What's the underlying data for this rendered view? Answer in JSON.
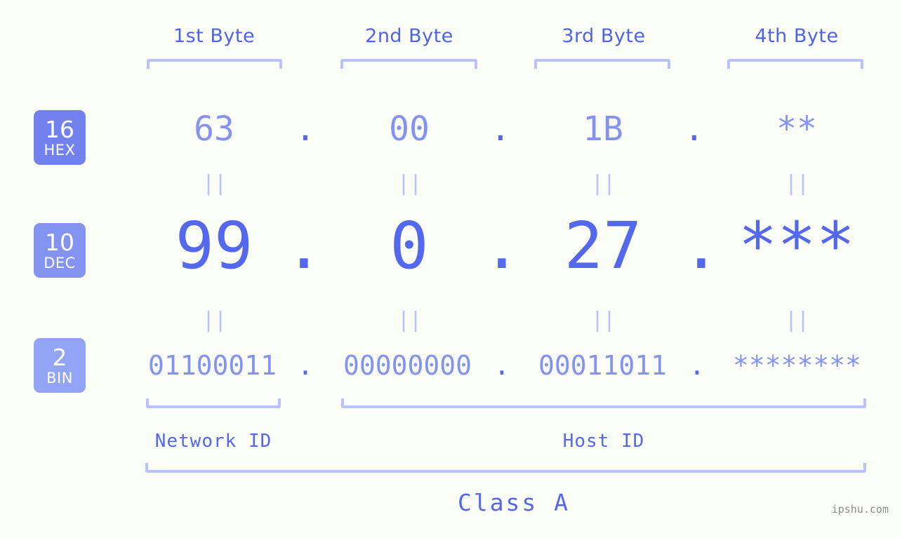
{
  "background": "#fbfdf7",
  "colors": {
    "accent_strong": "#5468ee",
    "accent_mid": "#8492f0",
    "accent_light": "#b9c2fb",
    "badge_hex": "#7381ee",
    "badge_dec": "#8492f0",
    "badge_bin": "#93a4f7",
    "watermark": "#8c8c8c"
  },
  "byte_headers": [
    {
      "label": "1st Byte"
    },
    {
      "label": "2nd Byte"
    },
    {
      "label": "3rd Byte"
    },
    {
      "label": "4th Byte"
    }
  ],
  "rows": [
    {
      "id": "hex",
      "badge": {
        "num": "16",
        "abbr": "HEX"
      },
      "values": [
        "63",
        "00",
        "1B",
        "**"
      ],
      "separator": "."
    },
    {
      "id": "dec",
      "badge": {
        "num": "10",
        "abbr": "DEC"
      },
      "values": [
        "99",
        "0",
        "27",
        "***"
      ],
      "separator": "."
    },
    {
      "id": "bin",
      "badge": {
        "num": "2",
        "abbr": "BIN"
      },
      "values": [
        "01100011",
        "00000000",
        "00011011",
        "********"
      ],
      "separator": "."
    }
  ],
  "equals_symbol": "||",
  "groups": [
    {
      "label": "Network ID"
    },
    {
      "label": "Host ID"
    }
  ],
  "class_label": "Class A",
  "watermark": "ipshu.com"
}
